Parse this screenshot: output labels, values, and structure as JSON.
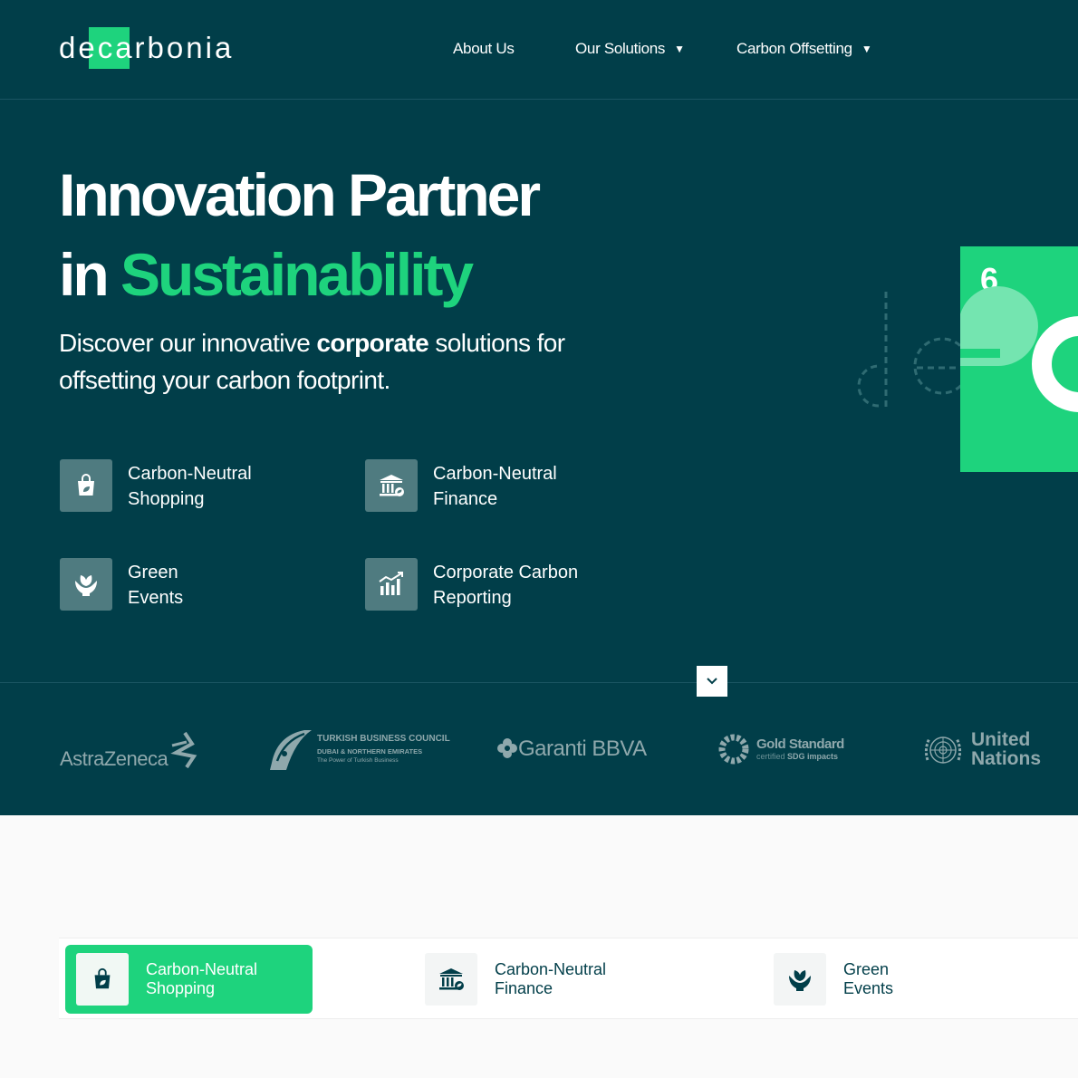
{
  "header": {
    "logo_text": "decarbonia",
    "nav": [
      {
        "label": "About Us"
      },
      {
        "label": "Our Solutions",
        "caret": "▼"
      },
      {
        "label": "Carbon Offsetting",
        "caret": "▼"
      }
    ]
  },
  "hero": {
    "title_line1": "Innovation Partner",
    "title_line2_prefix": "in",
    "title_line2_highlight": "Sustainability",
    "lead_part1": "Discover our innovative ",
    "lead_bold": "corporate",
    "lead_part2": " solutions for offsetting your carbon footprint.",
    "features": [
      {
        "line1": "Carbon-Neutral",
        "line2": "Shopping",
        "icon": "shopping-bag-leaf-icon"
      },
      {
        "line1": "Carbon-Neutral",
        "line2": "Finance",
        "icon": "bank-leaf-icon"
      },
      {
        "line1": "Green",
        "line2": "Events",
        "icon": "hands-leaf-icon"
      },
      {
        "line1": "Corporate Carbon",
        "line2": "Reporting",
        "icon": "chart-growth-icon"
      }
    ],
    "deco_number": "6",
    "scroll_icon": "chevron-down-icon"
  },
  "partners": {
    "astrazeneca": "AstraZeneca",
    "tbc_title": "TURKISH BUSINESS COUNCIL",
    "tbc_sub": "DUBAI & NORTHERN EMIRATES",
    "tbc_tag": "The Power of Turkish Business",
    "garanti": "Garanti BBVA",
    "gold_title": "Gold Standard",
    "gold_sub_1": "certified",
    "gold_sub_2": "SDG impacts",
    "un_line1": "United",
    "un_line2": "Nations"
  },
  "tabs": [
    {
      "line1": "Carbon-Neutral",
      "line2": "Shopping",
      "icon": "shopping-bag-leaf-icon",
      "active": true
    },
    {
      "line1": "Carbon-Neutral",
      "line2": "Finance",
      "icon": "bank-leaf-icon",
      "active": false
    },
    {
      "line1": "Green",
      "line2": "Events",
      "icon": "hands-leaf-icon",
      "active": false
    }
  ],
  "colors": {
    "brand_dark": "#013e49",
    "brand_green": "#1ed37d",
    "icon_tile": "#4f7b80",
    "partner_gray": "#8fa8ac"
  }
}
